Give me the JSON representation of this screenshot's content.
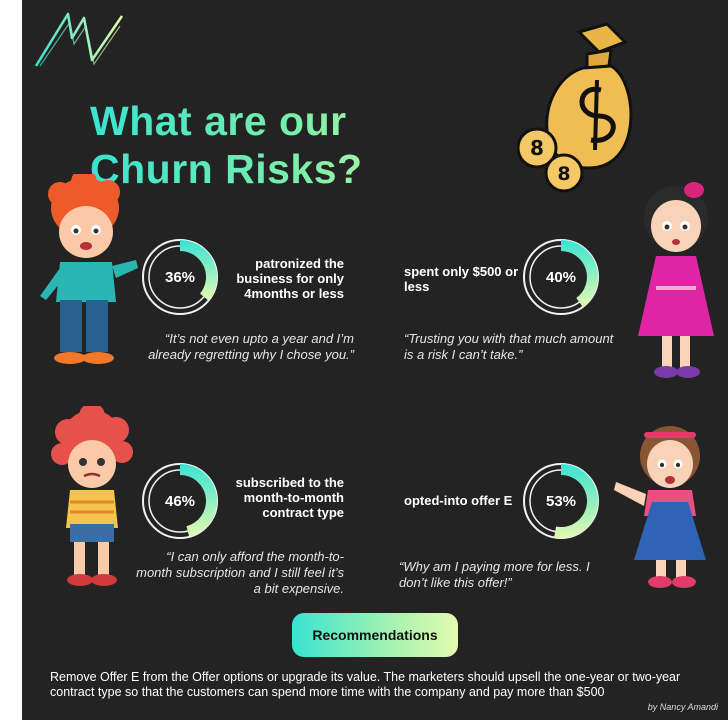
{
  "title_line1": "What are our",
  "title_line2": "Churn Risks?",
  "chart_data": {
    "type": "pie",
    "charts": [
      {
        "value": 36,
        "label": "36%",
        "caption": "patronized the business for only 4months or less",
        "quote": "“It’s not even upto a year and I’m already regretting why I chose you.”"
      },
      {
        "value": 40,
        "label": "40%",
        "caption": "spent only $500 or less",
        "quote": "“Trusting you with that much amount is a risk I can’t take.”"
      },
      {
        "value": 46,
        "label": "46%",
        "caption": "subscribed to the month-to-month contract type",
        "quote": "“I can only afford the month-to-month subscription and I still feel it’s a bit expensive."
      },
      {
        "value": 53,
        "label": "53%",
        "caption": "opted-into offer E",
        "quote": "“Why am I paying more for less. I don’t like this offer!”"
      }
    ]
  },
  "recommendations_label": "Recommendations",
  "recommendation_text": "Remove Offer E from the Offer options or upgrade its value. The marketers should upsell the one-year or two-year contract type so that the customers can spend more time with the company and pay more than $500",
  "credit": "by Nancy Amandi",
  "colors": {
    "accent_start": "#39e3d2",
    "accent_end": "#e4fbb0",
    "background": "#232323",
    "ring": "#f2f2f2"
  },
  "icons": [
    "logo-icon",
    "money-bag-icon",
    "kid-red-hair-icon",
    "girl-pink-dress-icon",
    "kid-curly-hair-icon",
    "girl-blue-overalls-icon"
  ]
}
